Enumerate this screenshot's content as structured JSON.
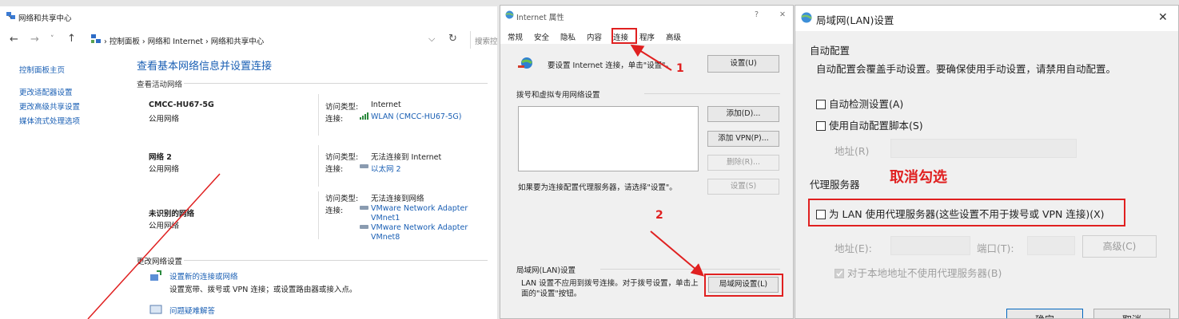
{
  "network_center": {
    "title": "网络和共享中心",
    "breadcrumb": [
      "控制面板",
      "网络和 Internet",
      "网络和共享中心"
    ],
    "search_placeholder": "搜索控",
    "sidebar": [
      "控制面板主页",
      "更改适配器设置",
      "更改高级共享设置",
      "媒体流式处理选项"
    ],
    "heading": "查看基本网络信息并设置连接",
    "active_label": "查看活动网络",
    "networks": [
      {
        "name": "CMCC-HU67-5G",
        "type": "公用网络",
        "access_label": "访问类型:",
        "access": "Internet",
        "conn_label": "连接:",
        "conn": "WLAN (CMCC-HU67-5G)"
      },
      {
        "name": "网络 2",
        "type": "公用网络",
        "access_label": "访问类型:",
        "access": "无法连接到 Internet",
        "conn_label": "连接:",
        "conn": "以太网 2"
      },
      {
        "name": "未识别的网络",
        "type": "公用网络",
        "access_label": "访问类型:",
        "access": "无法连接到网络",
        "conn_label": "连接:",
        "conn": "VMware Network Adapter VMnet1",
        "conn2": "VMware Network Adapter VMnet8"
      }
    ],
    "change_label": "更改网络设置",
    "tasks": [
      {
        "title": "设置新的连接或网络",
        "desc": "设置宽带、拨号或 VPN 连接；或设置路由器或接入点。"
      },
      {
        "title": "问题疑难解答"
      }
    ]
  },
  "internet_props": {
    "title": "Internet 属性",
    "help": "?",
    "close": "✕",
    "tabs": [
      "常规",
      "安全",
      "隐私",
      "内容",
      "连接",
      "程序",
      "高级"
    ],
    "active_tab": 4,
    "setup_text": "要设置 Internet 连接，单击\"设置\"。",
    "setup_btn": "设置(U)",
    "dialup_label": "拨号和虚拟专用网络设置",
    "add_btn": "添加(D)...",
    "add_vpn_btn": "添加 VPN(P)...",
    "remove_btn": "删除(R)...",
    "proxy_hint": "如果要为连接配置代理服务器，请选择\"设置\"。",
    "settings_btn": "设置(S)",
    "lan_label": "局域网(LAN)设置",
    "lan_text": "LAN 设置不应用到拨号连接。对于拨号设置，单击上面的\"设置\"按钮。",
    "lan_btn": "局域网设置(L)"
  },
  "lan_settings": {
    "title": "局域网(LAN)设置",
    "close": "✕",
    "auto_label": "自动配置",
    "auto_desc": "自动配置会覆盖手动设置。要确保使用手动设置，请禁用自动配置。",
    "auto_detect": "自动检测设置(A)",
    "auto_script": "使用自动配置脚本(S)",
    "address_label": "地址(R)",
    "proxy_label": "代理服务器",
    "use_proxy": "为 LAN 使用代理服务器(这些设置不用于拨号或 VPN 连接)(X)",
    "proxy_address": "地址(E):",
    "proxy_port": "端口(T):",
    "advanced_btn": "高级(C)",
    "bypass_local": "对于本地地址不使用代理服务器(B)",
    "ok_btn": "确定",
    "cancel_btn": "取消"
  },
  "annotations": {
    "step1": "1",
    "step2": "2",
    "uncheck_note": "取消勾选",
    "color": "#e02020"
  }
}
